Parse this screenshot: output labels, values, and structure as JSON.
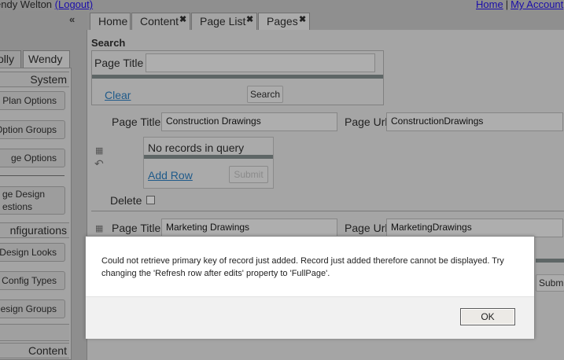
{
  "topbar": {
    "user_text": "endy Welton",
    "logout_label": "(Logout)",
    "home_label": "Home",
    "separator": "|",
    "account_label": "My Account"
  },
  "sidebar": {
    "collapse_glyph": "«",
    "tabs": [
      {
        "label": "olly"
      },
      {
        "label": "Wendy"
      }
    ],
    "sections": [
      {
        "label": "System"
      },
      {
        "label": "nfigurations"
      },
      {
        "label": "Content"
      }
    ],
    "buttons": [
      {
        "label": "Plan Options"
      },
      {
        "label": "Option Groups"
      },
      {
        "label": "ge Options"
      },
      {
        "label": "ge Design\nestions"
      },
      {
        "label": "Design Looks"
      },
      {
        "label": "Config Types"
      },
      {
        "label": "Design Groups"
      }
    ]
  },
  "tabs": [
    {
      "label": "Home",
      "closable": false
    },
    {
      "label": "Content",
      "closable": true
    },
    {
      "label": "Page List",
      "closable": true
    },
    {
      "label": "Pages",
      "closable": true,
      "active": true
    }
  ],
  "close_glyph": "✖",
  "search": {
    "heading": "Search",
    "field_label": "Page Title",
    "field_value": "",
    "clear_label": "Clear",
    "search_label": "Search"
  },
  "records": [
    {
      "title_label": "Page Title",
      "title_value": "Construction Drawings",
      "url_label": "Page Url",
      "url_value": "ConstructionDrawings",
      "empty_text": "No records in query",
      "add_row_label": "Add Row",
      "submit_label": "Submit",
      "delete_label": "Delete"
    },
    {
      "title_label": "Page Title",
      "title_value": "Marketing Drawings",
      "url_label": "Page Url",
      "url_value": "MarketingDrawings"
    }
  ],
  "partial_submit_label": "Submi",
  "dialog": {
    "message": "Could not retrieve primary key of record just added. Record just added therefore cannot be displayed. Try changing the 'Refresh row after edits' property to 'FullPage'.",
    "ok_label": "OK"
  }
}
